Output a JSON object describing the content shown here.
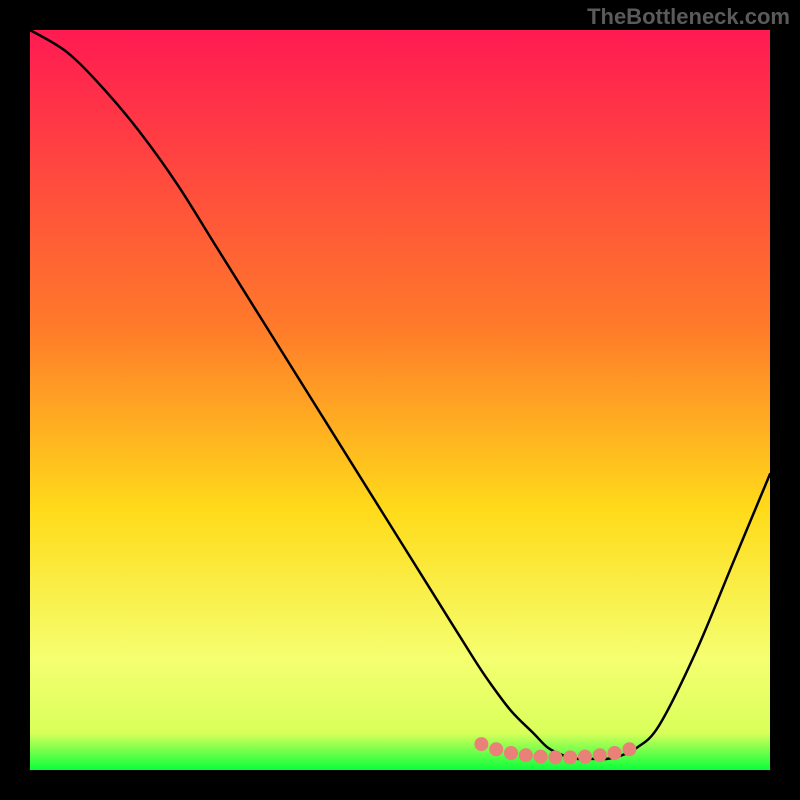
{
  "watermark": "TheBottleneck.com",
  "chart_data": {
    "type": "line",
    "title": "",
    "xlabel": "",
    "ylabel": "",
    "xlim": [
      0,
      100
    ],
    "ylim": [
      0,
      100
    ],
    "x": [
      0,
      5,
      10,
      15,
      20,
      25,
      30,
      35,
      40,
      45,
      50,
      55,
      60,
      62,
      65,
      68,
      70,
      72,
      74,
      76,
      78,
      80,
      82,
      85,
      90,
      95,
      100
    ],
    "y": [
      100,
      97,
      92,
      86,
      79,
      71,
      63,
      55,
      47,
      39,
      31,
      23,
      15,
      12,
      8,
      5,
      3,
      2,
      1.5,
      1.5,
      1.5,
      2,
      3,
      6,
      16,
      28,
      40
    ],
    "dot_markers": {
      "x": [
        61,
        63,
        65,
        67,
        69,
        71,
        73,
        75,
        77,
        79,
        81
      ],
      "y": [
        3.5,
        2.8,
        2.3,
        2.0,
        1.8,
        1.7,
        1.7,
        1.8,
        2.0,
        2.3,
        2.8
      ]
    },
    "gradient_stops": [
      {
        "pct": 0,
        "color": "#ff1a52"
      },
      {
        "pct": 40,
        "color": "#ff7a2a"
      },
      {
        "pct": 65,
        "color": "#ffdb1a"
      },
      {
        "pct": 85,
        "color": "#f5ff70"
      },
      {
        "pct": 95,
        "color": "#d9ff5a"
      },
      {
        "pct": 100,
        "color": "#0aff3a"
      }
    ],
    "marker_color": "#e98178",
    "line_color": "#000000"
  }
}
